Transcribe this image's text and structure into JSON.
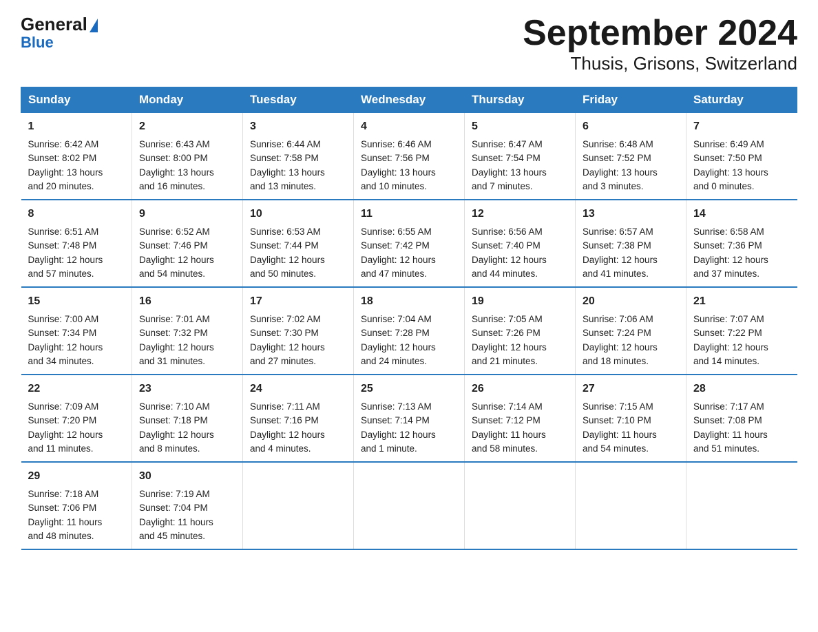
{
  "header": {
    "title": "September 2024",
    "subtitle": "Thusis, Grisons, Switzerland",
    "logo_general": "General",
    "logo_blue": "Blue"
  },
  "days_of_week": [
    "Sunday",
    "Monday",
    "Tuesday",
    "Wednesday",
    "Thursday",
    "Friday",
    "Saturday"
  ],
  "weeks": [
    [
      {
        "day": "1",
        "sunrise": "6:42 AM",
        "sunset": "8:02 PM",
        "daylight": "13 hours and 20 minutes."
      },
      {
        "day": "2",
        "sunrise": "6:43 AM",
        "sunset": "8:00 PM",
        "daylight": "13 hours and 16 minutes."
      },
      {
        "day": "3",
        "sunrise": "6:44 AM",
        "sunset": "7:58 PM",
        "daylight": "13 hours and 13 minutes."
      },
      {
        "day": "4",
        "sunrise": "6:46 AM",
        "sunset": "7:56 PM",
        "daylight": "13 hours and 10 minutes."
      },
      {
        "day": "5",
        "sunrise": "6:47 AM",
        "sunset": "7:54 PM",
        "daylight": "13 hours and 7 minutes."
      },
      {
        "day": "6",
        "sunrise": "6:48 AM",
        "sunset": "7:52 PM",
        "daylight": "13 hours and 3 minutes."
      },
      {
        "day": "7",
        "sunrise": "6:49 AM",
        "sunset": "7:50 PM",
        "daylight": "13 hours and 0 minutes."
      }
    ],
    [
      {
        "day": "8",
        "sunrise": "6:51 AM",
        "sunset": "7:48 PM",
        "daylight": "12 hours and 57 minutes."
      },
      {
        "day": "9",
        "sunrise": "6:52 AM",
        "sunset": "7:46 PM",
        "daylight": "12 hours and 54 minutes."
      },
      {
        "day": "10",
        "sunrise": "6:53 AM",
        "sunset": "7:44 PM",
        "daylight": "12 hours and 50 minutes."
      },
      {
        "day": "11",
        "sunrise": "6:55 AM",
        "sunset": "7:42 PM",
        "daylight": "12 hours and 47 minutes."
      },
      {
        "day": "12",
        "sunrise": "6:56 AM",
        "sunset": "7:40 PM",
        "daylight": "12 hours and 44 minutes."
      },
      {
        "day": "13",
        "sunrise": "6:57 AM",
        "sunset": "7:38 PM",
        "daylight": "12 hours and 41 minutes."
      },
      {
        "day": "14",
        "sunrise": "6:58 AM",
        "sunset": "7:36 PM",
        "daylight": "12 hours and 37 minutes."
      }
    ],
    [
      {
        "day": "15",
        "sunrise": "7:00 AM",
        "sunset": "7:34 PM",
        "daylight": "12 hours and 34 minutes."
      },
      {
        "day": "16",
        "sunrise": "7:01 AM",
        "sunset": "7:32 PM",
        "daylight": "12 hours and 31 minutes."
      },
      {
        "day": "17",
        "sunrise": "7:02 AM",
        "sunset": "7:30 PM",
        "daylight": "12 hours and 27 minutes."
      },
      {
        "day": "18",
        "sunrise": "7:04 AM",
        "sunset": "7:28 PM",
        "daylight": "12 hours and 24 minutes."
      },
      {
        "day": "19",
        "sunrise": "7:05 AM",
        "sunset": "7:26 PM",
        "daylight": "12 hours and 21 minutes."
      },
      {
        "day": "20",
        "sunrise": "7:06 AM",
        "sunset": "7:24 PM",
        "daylight": "12 hours and 18 minutes."
      },
      {
        "day": "21",
        "sunrise": "7:07 AM",
        "sunset": "7:22 PM",
        "daylight": "12 hours and 14 minutes."
      }
    ],
    [
      {
        "day": "22",
        "sunrise": "7:09 AM",
        "sunset": "7:20 PM",
        "daylight": "12 hours and 11 minutes."
      },
      {
        "day": "23",
        "sunrise": "7:10 AM",
        "sunset": "7:18 PM",
        "daylight": "12 hours and 8 minutes."
      },
      {
        "day": "24",
        "sunrise": "7:11 AM",
        "sunset": "7:16 PM",
        "daylight": "12 hours and 4 minutes."
      },
      {
        "day": "25",
        "sunrise": "7:13 AM",
        "sunset": "7:14 PM",
        "daylight": "12 hours and 1 minute."
      },
      {
        "day": "26",
        "sunrise": "7:14 AM",
        "sunset": "7:12 PM",
        "daylight": "11 hours and 58 minutes."
      },
      {
        "day": "27",
        "sunrise": "7:15 AM",
        "sunset": "7:10 PM",
        "daylight": "11 hours and 54 minutes."
      },
      {
        "day": "28",
        "sunrise": "7:17 AM",
        "sunset": "7:08 PM",
        "daylight": "11 hours and 51 minutes."
      }
    ],
    [
      {
        "day": "29",
        "sunrise": "7:18 AM",
        "sunset": "7:06 PM",
        "daylight": "11 hours and 48 minutes."
      },
      {
        "day": "30",
        "sunrise": "7:19 AM",
        "sunset": "7:04 PM",
        "daylight": "11 hours and 45 minutes."
      },
      null,
      null,
      null,
      null,
      null
    ]
  ],
  "labels": {
    "sunrise": "Sunrise:",
    "sunset": "Sunset:",
    "daylight": "Daylight:"
  }
}
